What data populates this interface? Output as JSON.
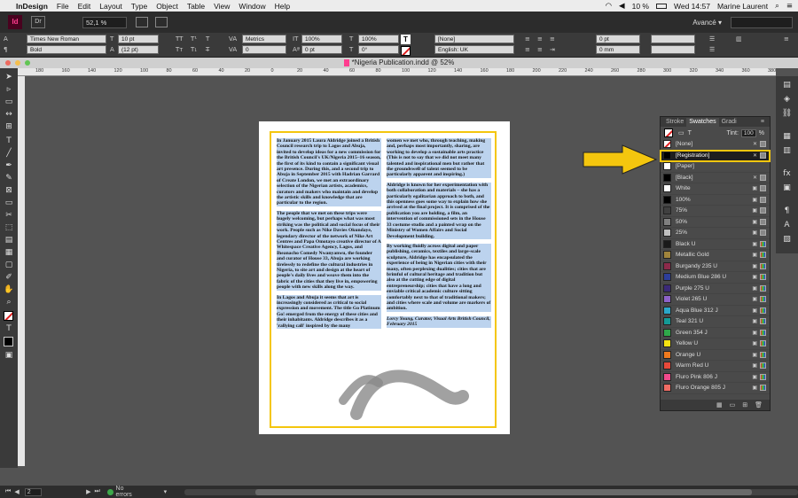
{
  "menubar": {
    "apple": "",
    "app": "InDesign",
    "items": [
      "File",
      "Edit",
      "Layout",
      "Type",
      "Object",
      "Table",
      "View",
      "Window",
      "Help"
    ],
    "battery": "10 %",
    "datetime": "Wed 14:57",
    "user": "Marine Laurent"
  },
  "appbar": {
    "logo": "Id",
    "doc_icon": "Dr",
    "zoom": "52,1 %",
    "workspace": "Avancé"
  },
  "control": {
    "font_family": "Times New Roman",
    "font_style": "Bold",
    "font_size": "10 pt",
    "leading": "(12 pt)",
    "kerning": "Metrics",
    "tracking": "0",
    "scale_v": "100%",
    "scale_h": "100%",
    "baseline": "0 pt",
    "skew": "0°",
    "char_style": "[None]",
    "language": "English: UK",
    "t_label": "T",
    "stroke_v": "0 pt",
    "ref": "0 mm"
  },
  "doc": {
    "title": "*Nigeria Publication.indd @ 52%"
  },
  "ruler": [
    "180",
    "160",
    "140",
    "120",
    "100",
    "80",
    "60",
    "40",
    "20",
    "0",
    "20",
    "40",
    "60",
    "80",
    "100",
    "120",
    "140",
    "160",
    "180",
    "200",
    "220",
    "240",
    "260",
    "280",
    "300",
    "320",
    "340",
    "360",
    "380"
  ],
  "article": {
    "col1": [
      "In January 2015 Laura Aldridge joined a British Council research trip to Lagos and Abuja, invited to develop ideas for a new commission for the British Council's UK/Nigeria 2015–16 season, the first of its kind to contain a significant visual art presence. During this, and a second trip to Abuja in September 2015 with Hadrian Garrard of Create London, we met an extraordinary selection of the Nigerian artists, academics, curators and makers who maintain and develop the artistic skills and knowledge that are particular to the region.",
      "The people that we met on these trips were hugely welcoming, but perhaps what was most striking was the political and social focus of their work. People such as Nike Davies Okundaye, legendary director of the network of Nike Art Centres and Papa Omotayo creative director of A Whitespace Creative Agency, Lagos, and Iheanacho Comedy Nwanyanwu, the founder and curator of House 33, Abuja are working tirelessly to redefine the cultural industries in Nigeria, to site art and design at the heart of people's daily lives and weave them into the fabric of the cities that they live in, empowering people with new skills along the way.",
      "In Lagos and Abuja it seems that art is increasingly considered as critical to social expression and movement. The title Go Platinum Go! emerged from the energy of these cities and their inhabitants. Aldridge describes it as a 'rallying call' inspired by the many"
    ],
    "col2": [
      "women we met who, through teaching, making and, perhaps most importantly, sharing, are working to develop a sustainable arts practice (This is not to say that we did not meet many talented and inspirational men but rather that the groundswell of talent seemed to be particularly apparent and inspiring.)",
      "Aldridge is known for her experimentation with both collaboration and materials – she has a particularly egalitarian approach to both, and this openness goes some way to explain how she arrived at the final project. It is comprised of the publication you are holding, a film, an intervention of commissioned sets in the House 33 costume studio and a painted wrap on the Ministry of Women Affairs and Social Development building.",
      "By working fluidly across digital and paper publishing, ceramics, textiles and large-scale sculpture, Aldridge has encapsulated the experience of being in Nigerian cities with their many, often perplexing dualities; cities that are brimful of cultural heritage and tradition but also at the cutting edge of digital entrepreneurship; cities that have a long and enviable critical academic culture sitting comfortably next to that of traditional makers; and cities where scale and volume are markers of ambition."
    ],
    "credit": "Lorcy Young, Curator, Visual Arts British Council, February 2015"
  },
  "swatches": {
    "tabs": [
      "Stroke",
      "Swatches",
      "Gradi"
    ],
    "tint_label": "Tint:",
    "tint_value": "100",
    "tint_unit": "%",
    "items": [
      {
        "name": "[None]",
        "color": "#ffffff"
      },
      {
        "name": "[Registration]",
        "color": "#000000"
      },
      {
        "name": "[Paper]",
        "color": "#ffffff"
      },
      {
        "name": "[Black]",
        "color": "#000000"
      },
      {
        "name": "White",
        "color": "#ffffff"
      },
      {
        "name": "100%",
        "color": "#000000"
      },
      {
        "name": "75%",
        "color": "#404040"
      },
      {
        "name": "50%",
        "color": "#808080"
      },
      {
        "name": "25%",
        "color": "#c0c0c0"
      },
      {
        "name": "Black U",
        "color": "#1a1a1a"
      },
      {
        "name": "Metallic Gold",
        "color": "#a0843c"
      },
      {
        "name": "Burgandy 235 U",
        "color": "#8c2a4a"
      },
      {
        "name": "Medium Blue 286 U",
        "color": "#2d3e9a"
      },
      {
        "name": "Purple 275 U",
        "color": "#3b2a78"
      },
      {
        "name": "Violet 265 U",
        "color": "#8d62c9"
      },
      {
        "name": "Aqua Blue 312 J",
        "color": "#2ba7c9"
      },
      {
        "name": "Teal 321 U",
        "color": "#149a96"
      },
      {
        "name": "Green 354 J",
        "color": "#2fa84a"
      },
      {
        "name": "Yellow U",
        "color": "#f5e311"
      },
      {
        "name": "Orange U",
        "color": "#f07a1e"
      },
      {
        "name": "Warm Red U",
        "color": "#e8493a"
      },
      {
        "name": "Fluro Pink 806 J",
        "color": "#f04a8c"
      },
      {
        "name": "Fluro Orange 805 J",
        "color": "#f06c64"
      }
    ]
  },
  "status": {
    "page": "2",
    "errors": "No errors"
  },
  "colors": {
    "accent": "#f4c60e",
    "selection": "#bcd3ee"
  }
}
